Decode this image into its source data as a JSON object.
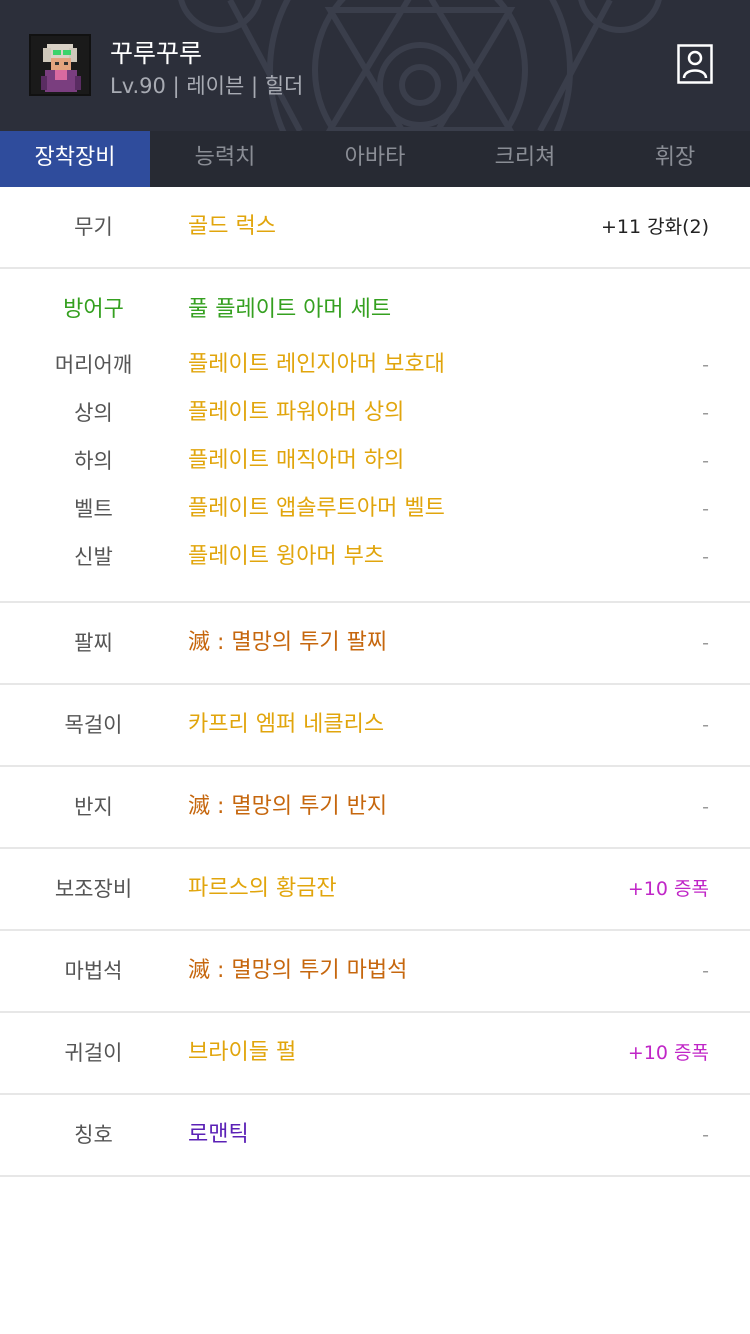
{
  "header": {
    "name": "꾸루꾸루",
    "info": "Lv.90 | 레이븐 | 힐더"
  },
  "tabs": [
    "장착장비",
    "능력치",
    "아바타",
    "크리쳐",
    "휘장"
  ],
  "equipment": {
    "weapon": {
      "label": "무기",
      "item": "골드 럭스",
      "extra": "+11 강화(2)"
    },
    "armor": {
      "label": "방어구",
      "set_name": "풀 플레이트 아머 세트",
      "pieces": [
        {
          "label": "머리어깨",
          "item": "플레이트 레인지아머 보호대",
          "extra": "-"
        },
        {
          "label": "상의",
          "item": "플레이트 파워아머 상의",
          "extra": "-"
        },
        {
          "label": "하의",
          "item": "플레이트 매직아머 하의",
          "extra": "-"
        },
        {
          "label": "벨트",
          "item": "플레이트 앱솔루트아머 벨트",
          "extra": "-"
        },
        {
          "label": "신발",
          "item": "플레이트 윙아머 부츠",
          "extra": "-"
        }
      ]
    },
    "bracelet": {
      "label": "팔찌",
      "item": "滅 : 멸망의 투기 팔찌",
      "extra": "-"
    },
    "necklace": {
      "label": "목걸이",
      "item": "카프리 엠퍼 네클리스",
      "extra": "-"
    },
    "ring": {
      "label": "반지",
      "item": "滅 : 멸망의 투기 반지",
      "extra": "-"
    },
    "subweapon": {
      "label": "보조장비",
      "item": "파르스의 황금잔",
      "extra": "+10 증폭"
    },
    "magicstone": {
      "label": "마법석",
      "item": "滅 : 멸망의 투기 마법석",
      "extra": "-"
    },
    "earring": {
      "label": "귀걸이",
      "item": "브라이들 펄",
      "extra": "+10 증폭"
    },
    "title": {
      "label": "칭호",
      "item": "로맨틱",
      "extra": "-"
    }
  },
  "colors": {
    "header_bg": "#2c2f3a",
    "tab_active": "#2f4c9c",
    "rare_item": "#e1a50c",
    "epic_item": "#c6670e",
    "unique_item": "#5b21b6",
    "set_green": "#35a020",
    "amplify": "#c026c7"
  },
  "icons": {
    "profile": "person-card-icon",
    "avatar": "character-avatar"
  }
}
